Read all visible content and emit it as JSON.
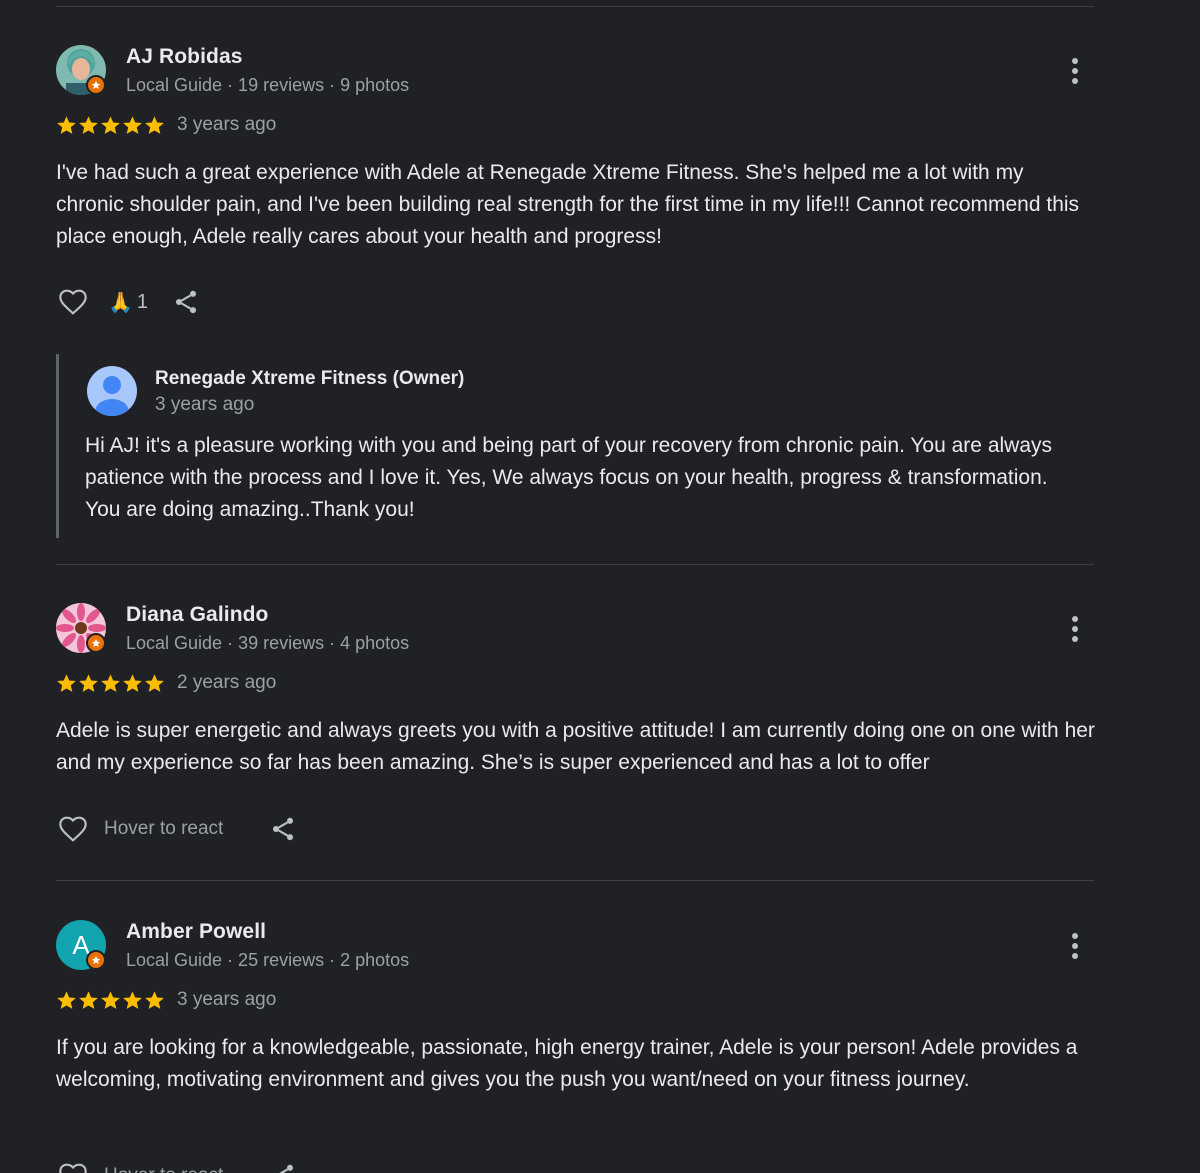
{
  "colors": {
    "background": "#202124",
    "star": "#fbbc04",
    "guide_badge": "#e8710a",
    "divider": "#3c4043"
  },
  "reviews": [
    {
      "name": "AJ Robidas",
      "meta": "Local Guide · 19 reviews · 9 photos",
      "rating": 5,
      "date": "3 years ago",
      "text": "I've had such a great experience with Adele at Renegade Xtreme Fitness. She's helped me a lot with my chronic shoulder pain, and I've been building real strength for the first time in my life!!! Cannot recommend this place enough, Adele really cares about your health and progress!",
      "reaction_emoji": "🙏",
      "reaction_count": "1",
      "owner_reply": {
        "name": "Renegade Xtreme Fitness (Owner)",
        "date": "3 years ago",
        "text": "Hi AJ! it's a pleasure working with you and being part of your recovery from chronic pain. You are always patience with the process and I love it. Yes, We always focus on your health, progress & transformation. You are doing amazing..Thank you!"
      }
    },
    {
      "name": "Diana Galindo",
      "meta": "Local Guide · 39 reviews · 4 photos",
      "rating": 5,
      "date": "2 years ago",
      "text": "Adele is super energetic and always greets you with a positive attitude! I am currently doing one on one with her and my experience so far has been amazing. She’s is super experienced and has a lot to offer",
      "hover_label": "Hover to react"
    },
    {
      "name": "Amber Powell",
      "avatar_letter": "A",
      "meta": "Local Guide · 25 reviews · 2 photos",
      "rating": 5,
      "date": "3 years ago",
      "text": "If you are looking for a knowledgeable, passionate, high energy trainer, Adele is your person! Adele provides a welcoming, motivating environment and gives you the push you want/need on your fitness journey.",
      "hover_label": "Hover to react"
    }
  ]
}
